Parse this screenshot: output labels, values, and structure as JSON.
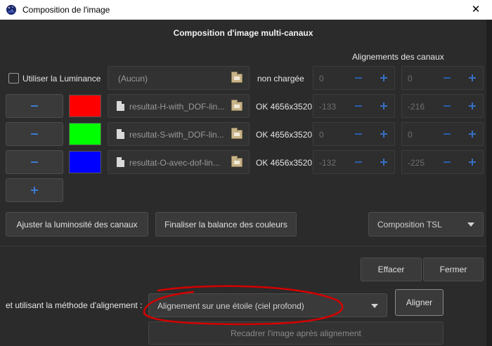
{
  "window": {
    "title": "Composition de l'image",
    "app_icon": "siril-icon",
    "close_icon": "close-icon"
  },
  "heading": "Composition d'image multi-canaux",
  "alignment_heading": "Alignements des canaux",
  "luminance": {
    "checkbox_label": "Utiliser la Luminance",
    "file_placeholder": "(Aucun)",
    "status": "non chargée",
    "x": "0",
    "y": "0"
  },
  "channels": [
    {
      "color": "#ff0000",
      "file": "resultat-H-with_DOF-lin...",
      "status": "OK 4656x3520",
      "x": "-133",
      "y": "-216"
    },
    {
      "color": "#00ff00",
      "file": "resultat-S-with_DOF-lin...",
      "status": "OK 4656x3520",
      "x": "0",
      "y": "0"
    },
    {
      "color": "#0000ff",
      "file": "resultat-O-avec-dof-lin...",
      "status": "OK 4656x3520",
      "x": "-132",
      "y": "-225"
    }
  ],
  "buttons": {
    "adjust_luminosity": "Ajuster la luminosité des canaux",
    "finalize_balance": "Finaliser la balance des couleurs",
    "composition_mode": "Composition TSL",
    "clear": "Effacer",
    "close": "Fermer",
    "align": "Aligner",
    "reframe": "Recadrer l'image après alignement"
  },
  "alignment_method": {
    "label": "et utilisant la méthode d'alignement :",
    "selected": "Alignement sur une étoile (ciel profond)"
  },
  "annotation": {
    "color": "#d40000"
  }
}
